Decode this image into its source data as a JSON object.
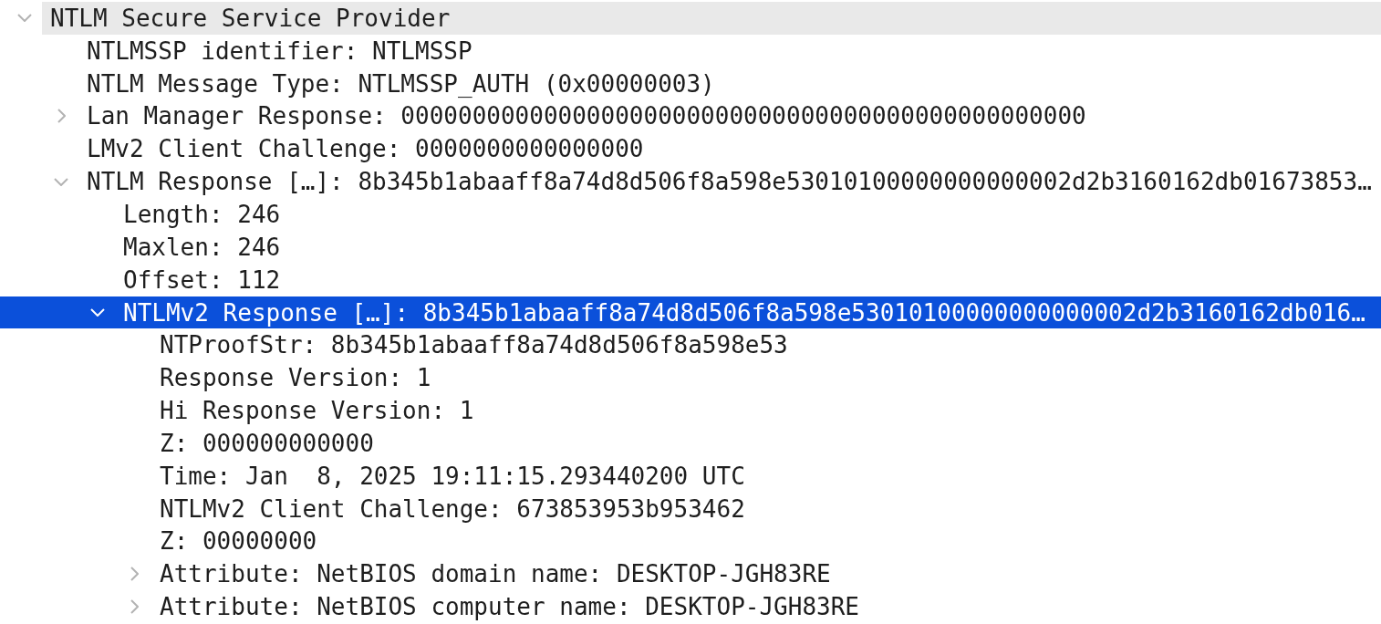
{
  "tree": {
    "items": [
      {
        "label": "NTLM Secure Service Provider",
        "kind": "branch",
        "expanded": true,
        "selected": false,
        "highlighted": true,
        "children": [
          {
            "label": "NTLMSSP identifier: NTLMSSP",
            "kind": "leaf",
            "selected": false,
            "highlighted": false
          },
          {
            "label": "NTLM Message Type: NTLMSSP_AUTH (0x00000003)",
            "kind": "leaf",
            "selected": false,
            "highlighted": false
          },
          {
            "label": "Lan Manager Response: 000000000000000000000000000000000000000000000000",
            "kind": "branch",
            "expanded": false,
            "selected": false,
            "highlighted": false
          },
          {
            "label": "LMv2 Client Challenge: 0000000000000000",
            "kind": "leaf",
            "selected": false,
            "highlighted": false
          },
          {
            "label": "NTLM Response […]: 8b345b1abaaff8a74d8d506f8a598e53010100000000000002d2b3160162db01673853…",
            "kind": "branch",
            "expanded": true,
            "selected": false,
            "highlighted": false,
            "children": [
              {
                "label": "Length: 246",
                "kind": "leaf",
                "selected": false,
                "highlighted": false
              },
              {
                "label": "Maxlen: 246",
                "kind": "leaf",
                "selected": false,
                "highlighted": false
              },
              {
                "label": "Offset: 112",
                "kind": "leaf",
                "selected": false,
                "highlighted": false
              },
              {
                "label": "NTLMv2 Response […]: 8b345b1abaaff8a74d8d506f8a598e53010100000000000002d2b3160162db016…",
                "kind": "branch",
                "expanded": true,
                "selected": true,
                "highlighted": false,
                "children": [
                  {
                    "label": "NTProofStr: 8b345b1abaaff8a74d8d506f8a598e53",
                    "kind": "leaf",
                    "selected": false,
                    "highlighted": false
                  },
                  {
                    "label": "Response Version: 1",
                    "kind": "leaf",
                    "selected": false,
                    "highlighted": false
                  },
                  {
                    "label": "Hi Response Version: 1",
                    "kind": "leaf",
                    "selected": false,
                    "highlighted": false
                  },
                  {
                    "label": "Z: 000000000000",
                    "kind": "leaf",
                    "selected": false,
                    "highlighted": false
                  },
                  {
                    "label": "Time: Jan  8, 2025 19:11:15.293440200 UTC",
                    "kind": "leaf",
                    "selected": false,
                    "highlighted": false
                  },
                  {
                    "label": "NTLMv2 Client Challenge: 673853953b953462",
                    "kind": "leaf",
                    "selected": false,
                    "highlighted": false
                  },
                  {
                    "label": "Z: 00000000",
                    "kind": "leaf",
                    "selected": false,
                    "highlighted": false
                  },
                  {
                    "label": "Attribute: NetBIOS domain name: DESKTOP-JGH83RE",
                    "kind": "branch",
                    "expanded": false,
                    "selected": false,
                    "highlighted": false
                  },
                  {
                    "label": "Attribute: NetBIOS computer name: DESKTOP-JGH83RE",
                    "kind": "branch",
                    "expanded": false,
                    "selected": false,
                    "highlighted": false
                  }
                ]
              }
            ]
          }
        ]
      }
    ]
  }
}
